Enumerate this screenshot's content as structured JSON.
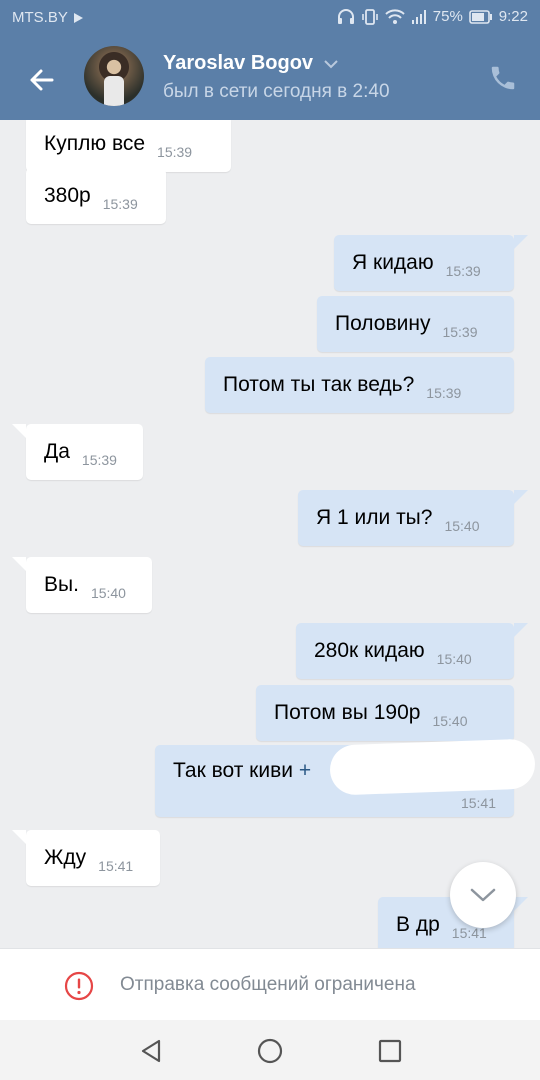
{
  "status_bar": {
    "carrier": "MTS.BY",
    "battery": "75%",
    "time": "9:22"
  },
  "header": {
    "name": "Yaroslav Bogov",
    "status": "был в сети сегодня в 2:40"
  },
  "messages": [
    {
      "dir": "in",
      "text": "Куплю все",
      "time": "15:39"
    },
    {
      "dir": "in",
      "text": "380р",
      "time": "15:39"
    },
    {
      "dir": "out",
      "text": "Я кидаю",
      "time": "15:39"
    },
    {
      "dir": "out",
      "text": "Половину",
      "time": "15:39"
    },
    {
      "dir": "out",
      "text": "Потом ты так ведь?",
      "time": "15:39"
    },
    {
      "dir": "in",
      "text": "Да",
      "time": "15:39"
    },
    {
      "dir": "out",
      "text": "Я 1 или ты?",
      "time": "15:40"
    },
    {
      "dir": "in",
      "text": "Вы.",
      "time": "15:40"
    },
    {
      "dir": "out",
      "text": "280к кидаю",
      "time": "15:40"
    },
    {
      "dir": "out",
      "text": "Потом вы 190р",
      "time": "15:40"
    },
    {
      "dir": "out",
      "text": "Так вот киви",
      "link": "+",
      "time": "15:41"
    },
    {
      "dir": "in",
      "text": "Жду",
      "time": "15:41"
    },
    {
      "dir": "out",
      "text": "В др",
      "time": "15:41"
    }
  ],
  "restriction": {
    "text": "Отправка сообщений ограничена"
  },
  "icons": {
    "back": "arrow-left-icon",
    "call": "phone-icon",
    "scroll": "chevron-down-icon",
    "warning": "exclamation-circle-icon"
  },
  "colors": {
    "header": "#5b7fa8",
    "incoming_bubble": "#ffffff",
    "outgoing_bubble": "#d6e4f5",
    "chat_background": "#edeef0",
    "warning": "#e64646"
  }
}
